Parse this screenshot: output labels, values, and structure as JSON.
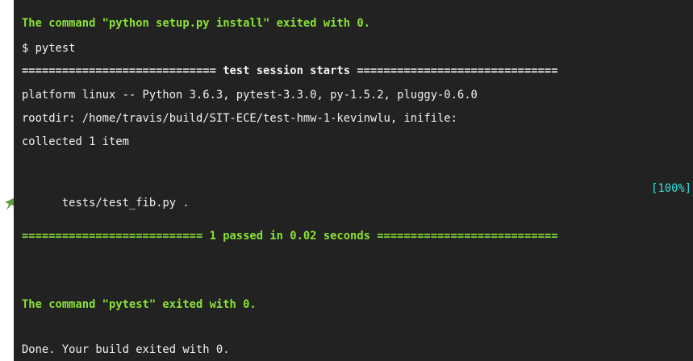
{
  "terminal": {
    "lines": {
      "cmd_setup_exit": "The command \"python setup.py install\" exited with 0.",
      "prompt_pytest": "$ pytest",
      "session_starts": "============================= test session starts ==============================",
      "platform": "platform linux -- Python 3.6.3, pytest-3.3.0, py-1.5.2, pluggy-0.6.0",
      "rootdir": "rootdir: /home/travis/build/SIT-ECE/test-hmw-1-kevinwlu, inifile:",
      "collected": "collected 1 item",
      "test_file": "tests/test_fib.py .",
      "progress": "[100%]",
      "passed_summary": "=========================== 1 passed in 0.02 seconds ===========================",
      "cmd_pytest_exit": "The command \"pytest\" exited with 0.",
      "done": "Done. Your build exited with 0."
    }
  },
  "colors": {
    "background": "#222222",
    "text": "#f1f1f1",
    "success_green": "#8ae234",
    "progress_cyan": "#34e2e2",
    "arrow_green": "#5d9c3f"
  },
  "icons": {
    "arrow": "arrow-pointer-icon"
  }
}
